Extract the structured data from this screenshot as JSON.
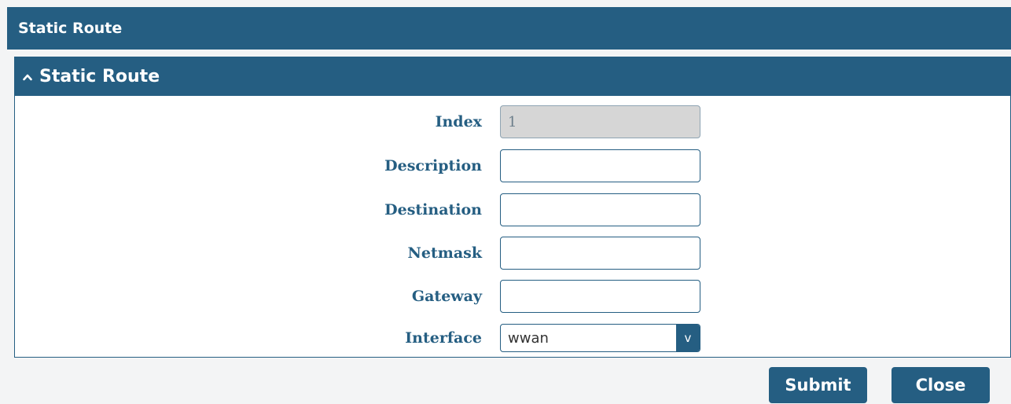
{
  "header": {
    "title": "Static Route"
  },
  "panel": {
    "title": "Static Route"
  },
  "form": {
    "index": {
      "label": "Index",
      "value": "1"
    },
    "description": {
      "label": "Description",
      "value": ""
    },
    "destination": {
      "label": "Destination",
      "value": ""
    },
    "netmask": {
      "label": "Netmask",
      "value": ""
    },
    "gateway": {
      "label": "Gateway",
      "value": ""
    },
    "interface": {
      "label": "Interface",
      "value": "wwan",
      "arrow": "v"
    }
  },
  "actions": {
    "submit": "Submit",
    "close": "Close"
  },
  "colors": {
    "primary": "#255e82",
    "background": "#f3f4f5",
    "readonly": "#d6d6d6"
  }
}
